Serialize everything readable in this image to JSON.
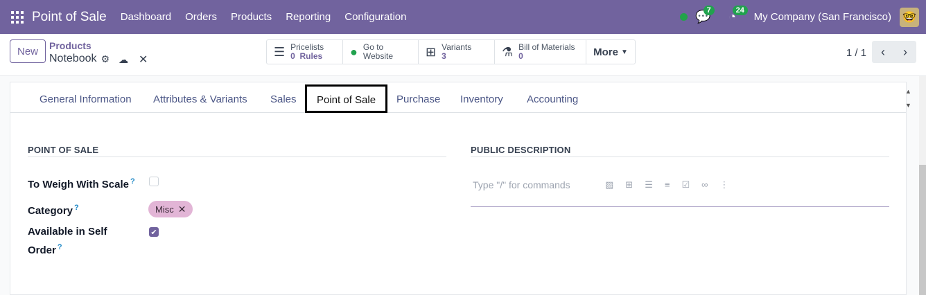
{
  "topbar": {
    "app_name": "Point of Sale",
    "menu": [
      "Dashboard",
      "Orders",
      "Products",
      "Reporting",
      "Configuration"
    ],
    "messages_count": "7",
    "activities_count": "24",
    "company": "My Company (San Francisco)"
  },
  "control": {
    "new_label": "New",
    "breadcrumb_parent": "Products",
    "record_name": "Notebook",
    "smart_buttons": {
      "pricelists": {
        "label": "Pricelists",
        "value": "0",
        "suffix": "Rules"
      },
      "website": {
        "line1": "Go to",
        "line2": "Website"
      },
      "variants": {
        "label": "Variants",
        "value": "3"
      },
      "bom": {
        "label": "Bill of Materials",
        "value": "0"
      },
      "more": "More"
    },
    "pager": "1 / 1"
  },
  "tabs": {
    "general": "General Information",
    "attributes": "Attributes & Variants",
    "sales": "Sales",
    "pos": "Point of Sale",
    "purchase": "Purchase",
    "inventory": "Inventory",
    "accounting": "Accounting"
  },
  "pos_section": {
    "title": "POINT OF SALE",
    "weigh_label": "To Weigh With Scale",
    "weigh_checked": false,
    "category_label": "Category",
    "category_tag": "Misc",
    "self_order_label_1": "Available in Self",
    "self_order_label_2": "Order",
    "self_order_checked": true,
    "help_mark": "?"
  },
  "description_section": {
    "title": "PUBLIC DESCRIPTION",
    "placeholder": "Type \"/\" for commands"
  },
  "colors": {
    "brand": "#71639e",
    "online": "#22a34a",
    "tag": "#e2b5d6"
  }
}
